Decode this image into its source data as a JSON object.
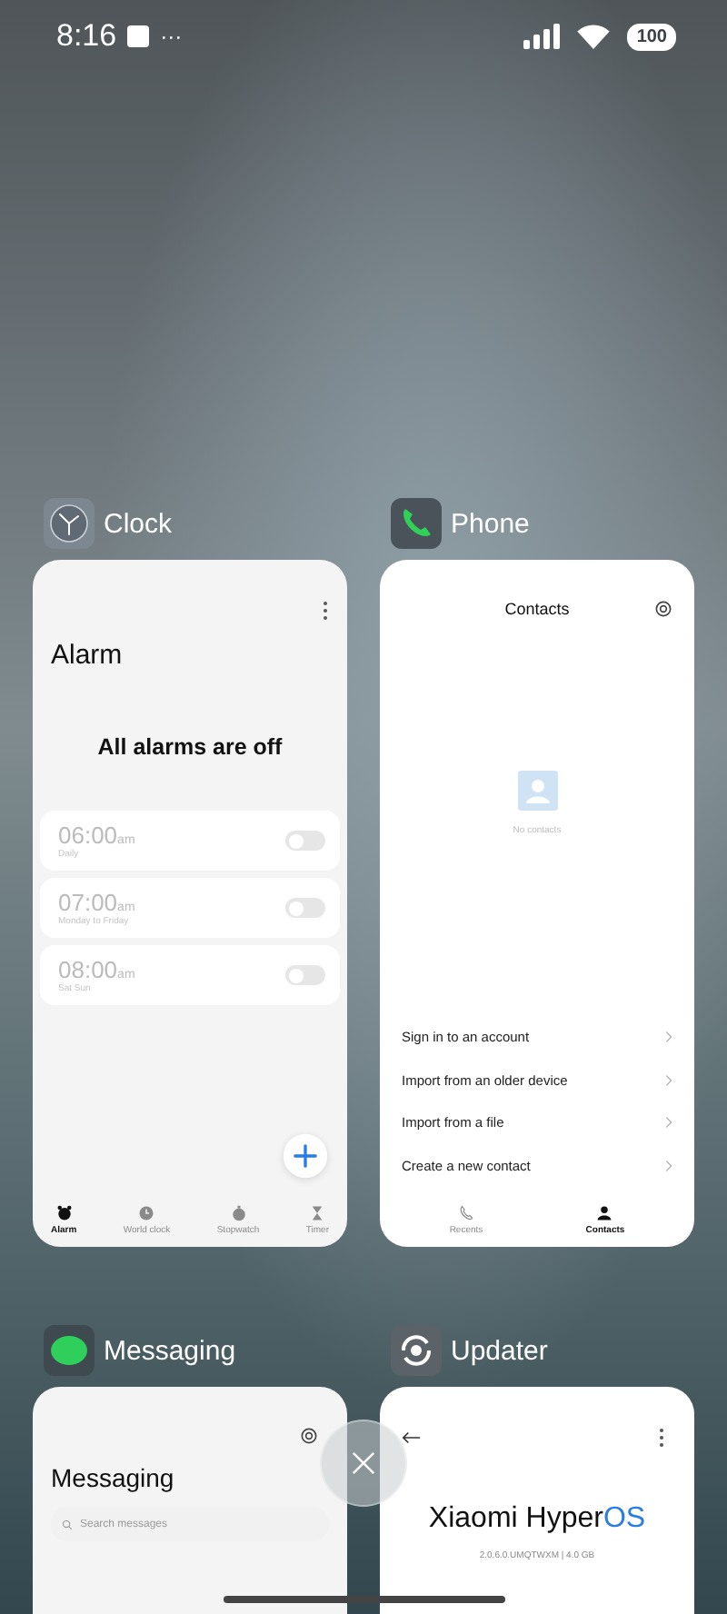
{
  "status_bar": {
    "time": "8:16",
    "overflow": "···",
    "battery": "100"
  },
  "apps": [
    {
      "kind": "clock",
      "name": "Clock",
      "screen": {
        "title": "Alarm",
        "empty_message": "All alarms are off",
        "alarms": [
          {
            "time": "06:00",
            "suffix": "am",
            "repeat": "Daily",
            "on": false
          },
          {
            "time": "07:00",
            "suffix": "am",
            "repeat": "Monday to Friday",
            "on": false
          },
          {
            "time": "08:00",
            "suffix": "am",
            "repeat": "Sat Sun",
            "on": false
          }
        ],
        "tabs": [
          {
            "label": "Alarm",
            "kind": "alarm",
            "selected": true
          },
          {
            "label": "World clock",
            "kind": "clock",
            "selected": false
          },
          {
            "label": "Stopwatch",
            "kind": "stopwatch",
            "selected": false
          },
          {
            "label": "Timer",
            "kind": "hourglass",
            "selected": false
          }
        ]
      }
    },
    {
      "kind": "phone",
      "name": "Phone",
      "screen": {
        "title": "Contacts",
        "empty_message": "No contacts",
        "actions": [
          "Sign in to an account",
          "Import from an older device",
          "Import from a file",
          "Create a new contact"
        ],
        "tabs": [
          {
            "label": "Recents",
            "kind": "phone",
            "selected": false
          },
          {
            "label": "Contacts",
            "kind": "person",
            "selected": true
          }
        ]
      }
    },
    {
      "kind": "messaging",
      "name": "Messaging",
      "screen": {
        "title": "Messaging",
        "search": {
          "placeholder": "Search messages"
        }
      }
    },
    {
      "kind": "updater",
      "name": "Updater",
      "screen": {
        "brand": "Xiaomi Hyper",
        "brand_accent": "OS",
        "version": "2.0.6.0.UMQTWXM | 4.0 GB"
      }
    }
  ]
}
